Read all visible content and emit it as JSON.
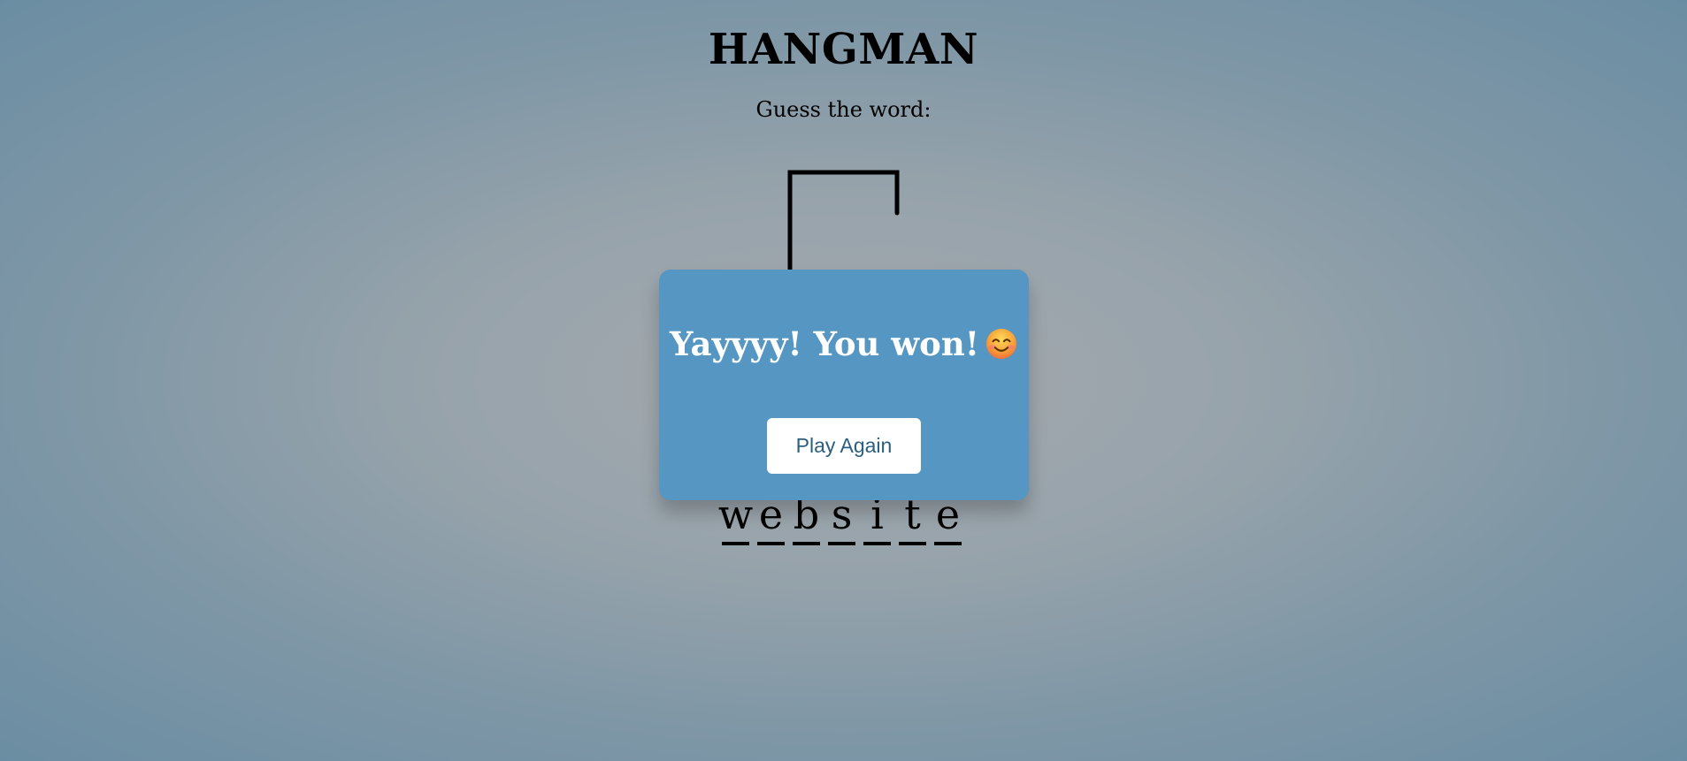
{
  "header": {
    "title": "HANGMAN",
    "subtitle": "Guess the word:"
  },
  "word": {
    "letters": [
      "w",
      "e",
      "b",
      "s",
      "i",
      "t",
      "e"
    ]
  },
  "popup": {
    "message": "Yayyyy! You won!",
    "emoji_icon": "smiling-face-icon",
    "button_label": "Play Again"
  },
  "colors": {
    "popup_background": "#5597c2",
    "button_text": "#2a5f7f"
  }
}
